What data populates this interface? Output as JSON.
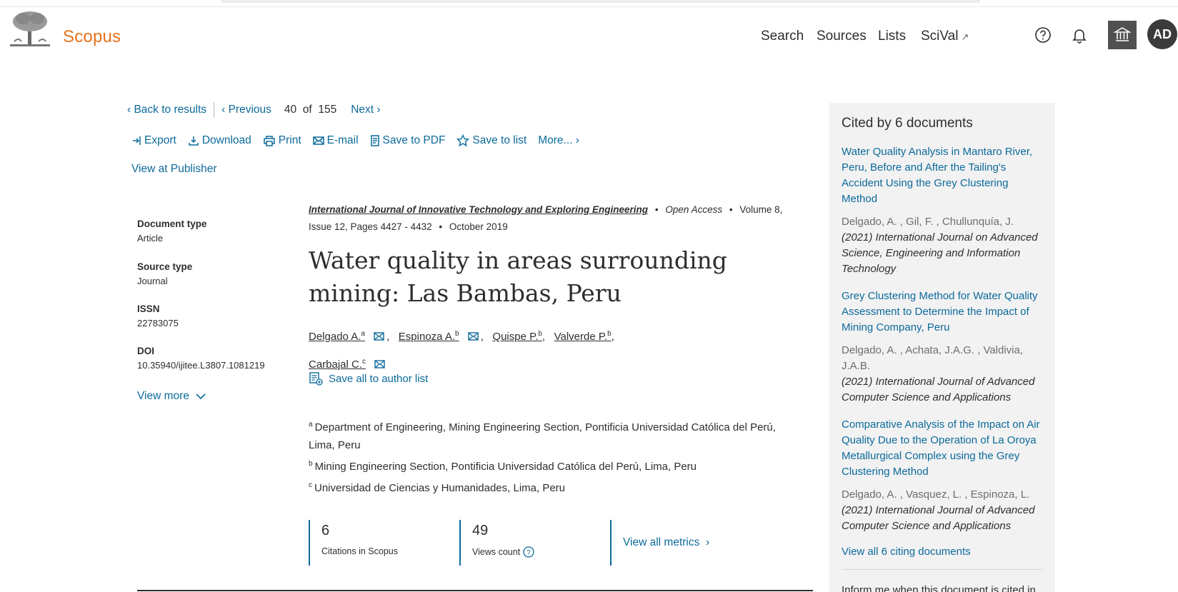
{
  "header": {
    "brand": "Scopus",
    "nav": [
      "Search",
      "Sources",
      "Lists",
      "SciVal"
    ],
    "scival_ext": "↗",
    "avatar_initials": "AD"
  },
  "result_nav": {
    "back": "Back to results",
    "previous": "Previous",
    "current": "40",
    "of": "of",
    "total": "155",
    "next": "Next"
  },
  "toolbar": {
    "export": "Export",
    "download": "Download",
    "print": "Print",
    "email": "E-mail",
    "save_pdf": "Save to PDF",
    "save_list": "Save to list",
    "more": "More..."
  },
  "view_at_publisher": "View at Publisher",
  "document": {
    "type_label": "Document type",
    "type_value": "Article",
    "source_type_label": "Source type",
    "source_type_value": "Journal",
    "issn_label": "ISSN",
    "issn_value": "22783075",
    "doi_label": "DOI",
    "doi_value": "10.35940/ijitee.L3807.1081219",
    "view_more": "View more"
  },
  "article": {
    "journal": "International Journal of Innovative Technology and Exploring Engineering",
    "open_access": "Open Access",
    "volume_pages": "Volume 8, Issue 12, Pages 4427 - 4432",
    "date": "October 2019",
    "title": "Water quality in areas surrounding mining: Las Bambas, Peru",
    "authors": [
      {
        "name": "Delgado A.",
        "sup": "a"
      },
      {
        "name": "Espinoza A.",
        "sup": "b"
      },
      {
        "name": "Quispe P.",
        "sup": "b"
      },
      {
        "name": "Valverde P.",
        "sup": "b"
      },
      {
        "name": "Carbajal C.",
        "sup": "c"
      }
    ],
    "save_authors": "Save all to author list",
    "affiliations": [
      {
        "sup": "a",
        "text": "Department of Engineering, Mining Engineering Section, Pontificia Universidad Católica del Perú, Lima, Peru"
      },
      {
        "sup": "b",
        "text": "Mining Engineering Section, Pontificia Universidad Católica del Perú, Lima, Peru"
      },
      {
        "sup": "c",
        "text": "Universidad de Ciencias y Humanidades, Lima, Peru"
      }
    ]
  },
  "metrics": {
    "citations_value": "6",
    "citations_label": "Citations in Scopus",
    "views_value": "49",
    "views_label": "Views count",
    "view_all": "View all metrics"
  },
  "sidebar": {
    "title": "Cited by 6 documents",
    "citations": [
      {
        "title": "Water Quality Analysis in Mantaro River, Peru, Before and After the Tailing's Accident Using the Grey Clustering Method",
        "authors": "Delgado, A. , Gil, F. , Chullunquía, J.",
        "source": "(2021) International Journal on Advanced Science, Engineering and Information Technology"
      },
      {
        "title": "Grey Clustering Method for Water Quality Assessment to Determine the Impact of Mining Company, Peru",
        "authors": "Delgado, A. , Achata, J.A.G. , Valdivia, J.A.B.",
        "source": "(2021) International Journal of Advanced Computer Science and Applications"
      },
      {
        "title": "Comparative Analysis of the Impact on Air Quality Due to the Operation of La Oroya Metallurgical Complex using the Grey Clustering Method",
        "authors": "Delgado, A. , Vasquez, L. , Espinoza, L.",
        "source": "(2021) International Journal of Advanced Computer Science and Applications"
      }
    ],
    "view_all": "View all 6 citing documents",
    "inform": "Inform me when this document is cited in Scopus:"
  }
}
